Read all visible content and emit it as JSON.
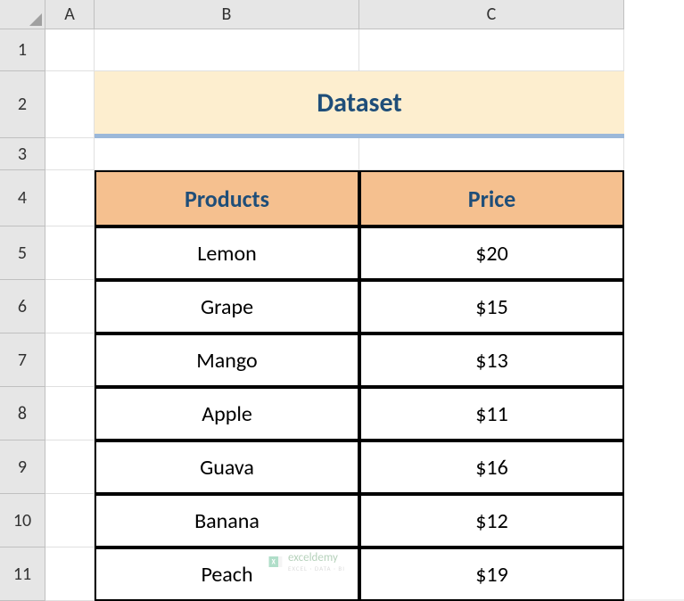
{
  "columns": {
    "A": "A",
    "B": "B",
    "C": "C"
  },
  "rows": {
    "1": "1",
    "2": "2",
    "3": "3",
    "4": "4",
    "5": "5",
    "6": "6",
    "7": "7",
    "8": "8",
    "9": "9",
    "10": "10",
    "11": "11"
  },
  "title": "Dataset",
  "table": {
    "headers": {
      "products": "Products",
      "price": "Price"
    },
    "rows": [
      {
        "product": "Lemon",
        "price": "$20"
      },
      {
        "product": "Grape",
        "price": "$15"
      },
      {
        "product": "Mango",
        "price": "$13"
      },
      {
        "product": "Apple",
        "price": "$11"
      },
      {
        "product": "Guava",
        "price": "$16"
      },
      {
        "product": "Banana",
        "price": "$12"
      },
      {
        "product": "Peach",
        "price": "$19"
      }
    ]
  },
  "watermark": {
    "brand": "exceldemy",
    "tagline": "EXCEL · DATA · BI"
  }
}
